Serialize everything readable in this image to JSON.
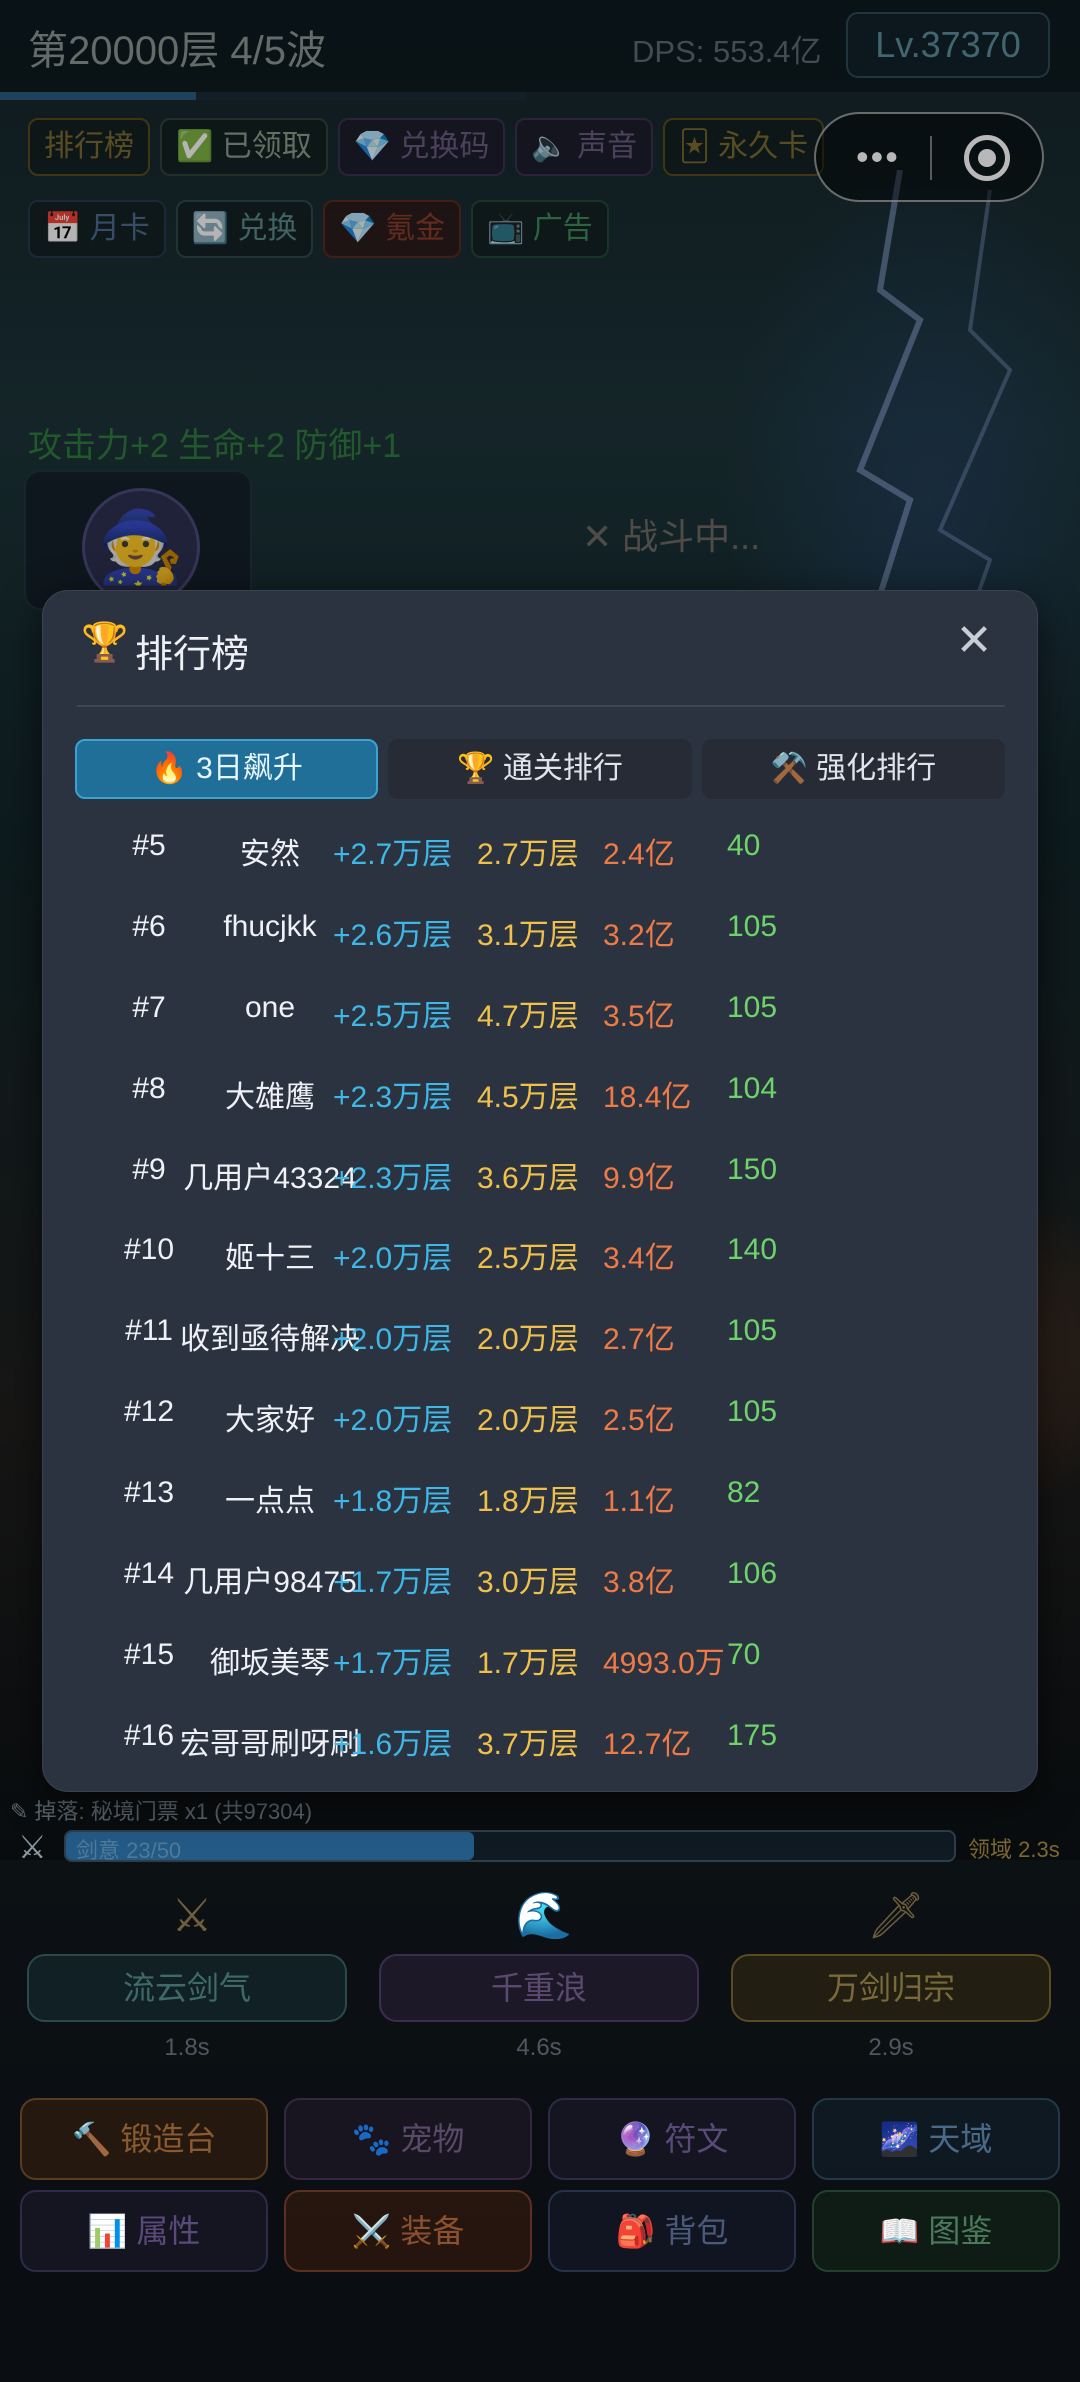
{
  "header": {
    "stage": "第20000层 4/5波",
    "dps": "DPS: 553.4亿",
    "level": "Lv.37370"
  },
  "top_buttons": [
    {
      "label": "排行榜"
    },
    {
      "label": "✅ 已领取"
    },
    {
      "label": "💎 兑换码"
    },
    {
      "label": "🔈 声音"
    },
    {
      "label": "🃏 永久卡"
    }
  ],
  "second_buttons": [
    {
      "label": "📅 月卡"
    },
    {
      "label": "🔄 兑换"
    },
    {
      "label": "💎 氪金"
    },
    {
      "label": "📺 广告"
    }
  ],
  "mini_program": {
    "more": "•••"
  },
  "battle": {
    "stat_bonus": "攻击力+2 生命+2 防御+1",
    "status": "✕ 战斗中..."
  },
  "log_line": "✎ 掉落: 秘境门票 x1 (共97304)",
  "skill_bar": {
    "label": "剑意 23/50",
    "fill_fraction": 0.46,
    "right_label": "领域 2.3s"
  },
  "skills": [
    {
      "name": "流云剑气",
      "time": "1.8s"
    },
    {
      "name": "千重浪",
      "time": "4.6s"
    },
    {
      "name": "万剑归宗",
      "time": "2.9s"
    }
  ],
  "nav": [
    {
      "label": "🔨 锻造台"
    },
    {
      "label": "🐾 宠物"
    },
    {
      "label": "🔮 符文"
    },
    {
      "label": "🌌 天域"
    },
    {
      "label": "📊 属性"
    },
    {
      "label": "⚔️ 装备"
    },
    {
      "label": "🎒 背包"
    },
    {
      "label": "📖 图鉴"
    }
  ],
  "modal": {
    "title_icon": "🏆",
    "title": "排行榜",
    "close": "✕",
    "tabs": [
      {
        "label": "🔥 3日飙升",
        "active": true
      },
      {
        "label": "🏆 通关排行",
        "active": false
      },
      {
        "label": "⚒️ 强化排行",
        "active": false
      }
    ],
    "rows": [
      {
        "rank": "#5",
        "name": "安然",
        "gain": "+2.7万层",
        "floor": "2.7万层",
        "power": "2.4亿",
        "level": "40"
      },
      {
        "rank": "#6",
        "name": "fhucjkk",
        "gain": "+2.6万层",
        "floor": "3.1万层",
        "power": "3.2亿",
        "level": "105"
      },
      {
        "rank": "#7",
        "name": "one",
        "gain": "+2.5万层",
        "floor": "4.7万层",
        "power": "3.5亿",
        "level": "105"
      },
      {
        "rank": "#8",
        "name": "大雄鹰",
        "gain": "+2.3万层",
        "floor": "4.5万层",
        "power": "18.4亿",
        "level": "104"
      },
      {
        "rank": "#9",
        "name": "几用户43324",
        "gain": "+2.3万层",
        "floor": "3.6万层",
        "power": "9.9亿",
        "level": "150"
      },
      {
        "rank": "#10",
        "name": "姬十三",
        "gain": "+2.0万层",
        "floor": "2.5万层",
        "power": "3.4亿",
        "level": "140"
      },
      {
        "rank": "#11",
        "name": "收到亟待解决",
        "gain": "+2.0万层",
        "floor": "2.0万层",
        "power": "2.7亿",
        "level": "105"
      },
      {
        "rank": "#12",
        "name": "大家好",
        "gain": "+2.0万层",
        "floor": "2.0万层",
        "power": "2.5亿",
        "level": "105"
      },
      {
        "rank": "#13",
        "name": "一点点",
        "gain": "+1.8万层",
        "floor": "1.8万层",
        "power": "1.1亿",
        "level": "82"
      },
      {
        "rank": "#14",
        "name": "几用户98475",
        "gain": "+1.7万层",
        "floor": "3.0万层",
        "power": "3.8亿",
        "level": "106"
      },
      {
        "rank": "#15",
        "name": "御坂美琴",
        "gain": "+1.7万层",
        "floor": "1.7万层",
        "power": "4993.0万",
        "level": "70"
      },
      {
        "rank": "#16",
        "name": "宏哥哥刷呀刷",
        "gain": "+1.6万层",
        "floor": "3.7万层",
        "power": "12.7亿",
        "level": "175"
      }
    ]
  },
  "colors": {
    "accent": "#1f6f98",
    "gain": "#3db8e8",
    "floor": "#f0c04a",
    "power": "#ef7a45",
    "level": "#6dd46a"
  }
}
